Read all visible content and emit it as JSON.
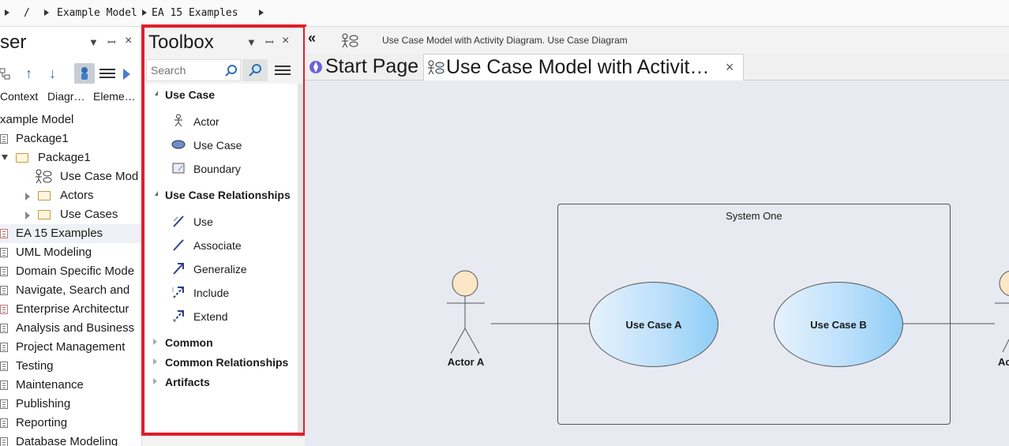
{
  "breadcrumb": {
    "root": "/",
    "items": [
      "Example Model",
      "EA 15 Examples"
    ]
  },
  "browser": {
    "title": "ser",
    "tabs": [
      "Context",
      "Diagr…",
      "Eleme…"
    ],
    "tree": [
      {
        "label": "xample Model"
      },
      {
        "label": "Package1"
      },
      {
        "label": "Package1"
      },
      {
        "label": "Use Case Mod"
      },
      {
        "label": "Actors"
      },
      {
        "label": "Use Cases"
      },
      {
        "label": "EA 15 Examples"
      },
      {
        "label": "UML Modeling"
      },
      {
        "label": "Domain Specific Mode"
      },
      {
        "label": "Navigate, Search and"
      },
      {
        "label": "Enterprise Architectur"
      },
      {
        "label": "Analysis and Business"
      },
      {
        "label": "Project Management"
      },
      {
        "label": "Testing"
      },
      {
        "label": "Maintenance"
      },
      {
        "label": "Publishing"
      },
      {
        "label": "Reporting"
      },
      {
        "label": "Database Modeling"
      }
    ]
  },
  "toolbox": {
    "title": "Toolbox",
    "search_placeholder": "Search",
    "sections": [
      {
        "label": "Use Case",
        "items": [
          "Actor",
          "Use Case",
          "Boundary"
        ]
      },
      {
        "label": "Use Case Relationships",
        "items": [
          "Use",
          "Associate",
          "Generalize",
          "Include",
          "Extend"
        ]
      },
      {
        "label": "Common",
        "items": []
      },
      {
        "label": "Common Relationships",
        "items": []
      },
      {
        "label": "Artifacts",
        "items": []
      }
    ]
  },
  "diagram": {
    "caption": "Use Case Model with Activity Diagram.  Use Case Diagram",
    "tabs": [
      "Start Page",
      "Use Case Model with Activit…"
    ],
    "boundary_label": "System One",
    "actor_a": "Actor A",
    "actor_b_partial": "Ac",
    "use_case_a": "Use Case A",
    "use_case_b": "Use Case B"
  },
  "colors": {
    "highlight_frame": "#e11d2a",
    "canvas_bg": "#e8eaf2",
    "actor_head": "#fbe7c6",
    "use_case_fill": "#bde0fb"
  }
}
